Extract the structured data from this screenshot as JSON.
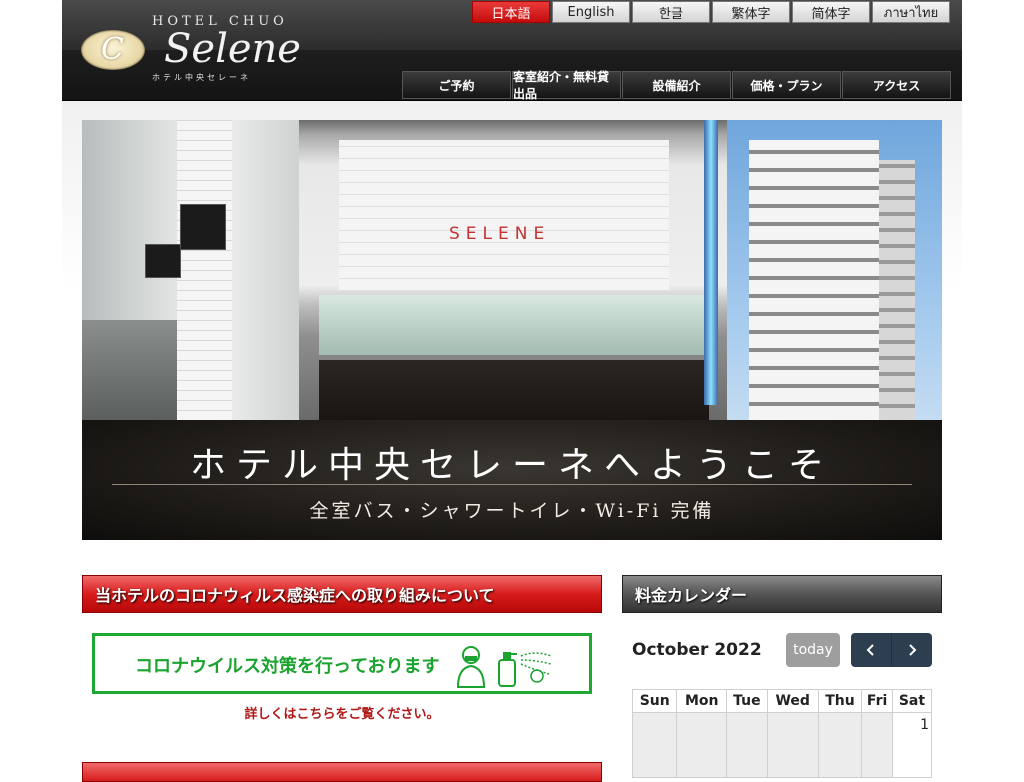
{
  "brand": {
    "hotel": "HOTEL CHUO",
    "script": "Selene",
    "kana": "ホテル中央セレーネ",
    "emblem": "C"
  },
  "languages": [
    "日本語",
    "English",
    "한글",
    "繁体字",
    "简体字",
    "ภาษาไทย"
  ],
  "active_language": "日本語",
  "nav": [
    "ご予約",
    "客室紹介・無料貸出品",
    "設備紹介",
    "価格・プラン",
    "アクセス"
  ],
  "hero": {
    "sign_text": "SELENE",
    "title": "ホテル中央セレーネへようこそ",
    "subtitle": "全室バス・シャワートイレ・Wi-Fi 完備"
  },
  "corona": {
    "heading": "当ホテルのコロナウィルス感染症への取り組みについて",
    "banner_text": "コロナウイルス対策を行っております",
    "link_text": "詳しくはこちらをご覧ください。"
  },
  "calendar": {
    "heading": "料金カレンダー",
    "month_title": "October 2022",
    "today_label": "today",
    "weekdays": [
      "Sun",
      "Mon",
      "Tue",
      "Wed",
      "Thu",
      "Fri",
      "Sat"
    ],
    "first_row": [
      "",
      "",
      "",
      "",
      "",
      "",
      "1"
    ]
  },
  "colors": {
    "accent_red": "#d81c1c",
    "banner_green": "#1ca832",
    "calendar_button": "#2c3e50"
  }
}
